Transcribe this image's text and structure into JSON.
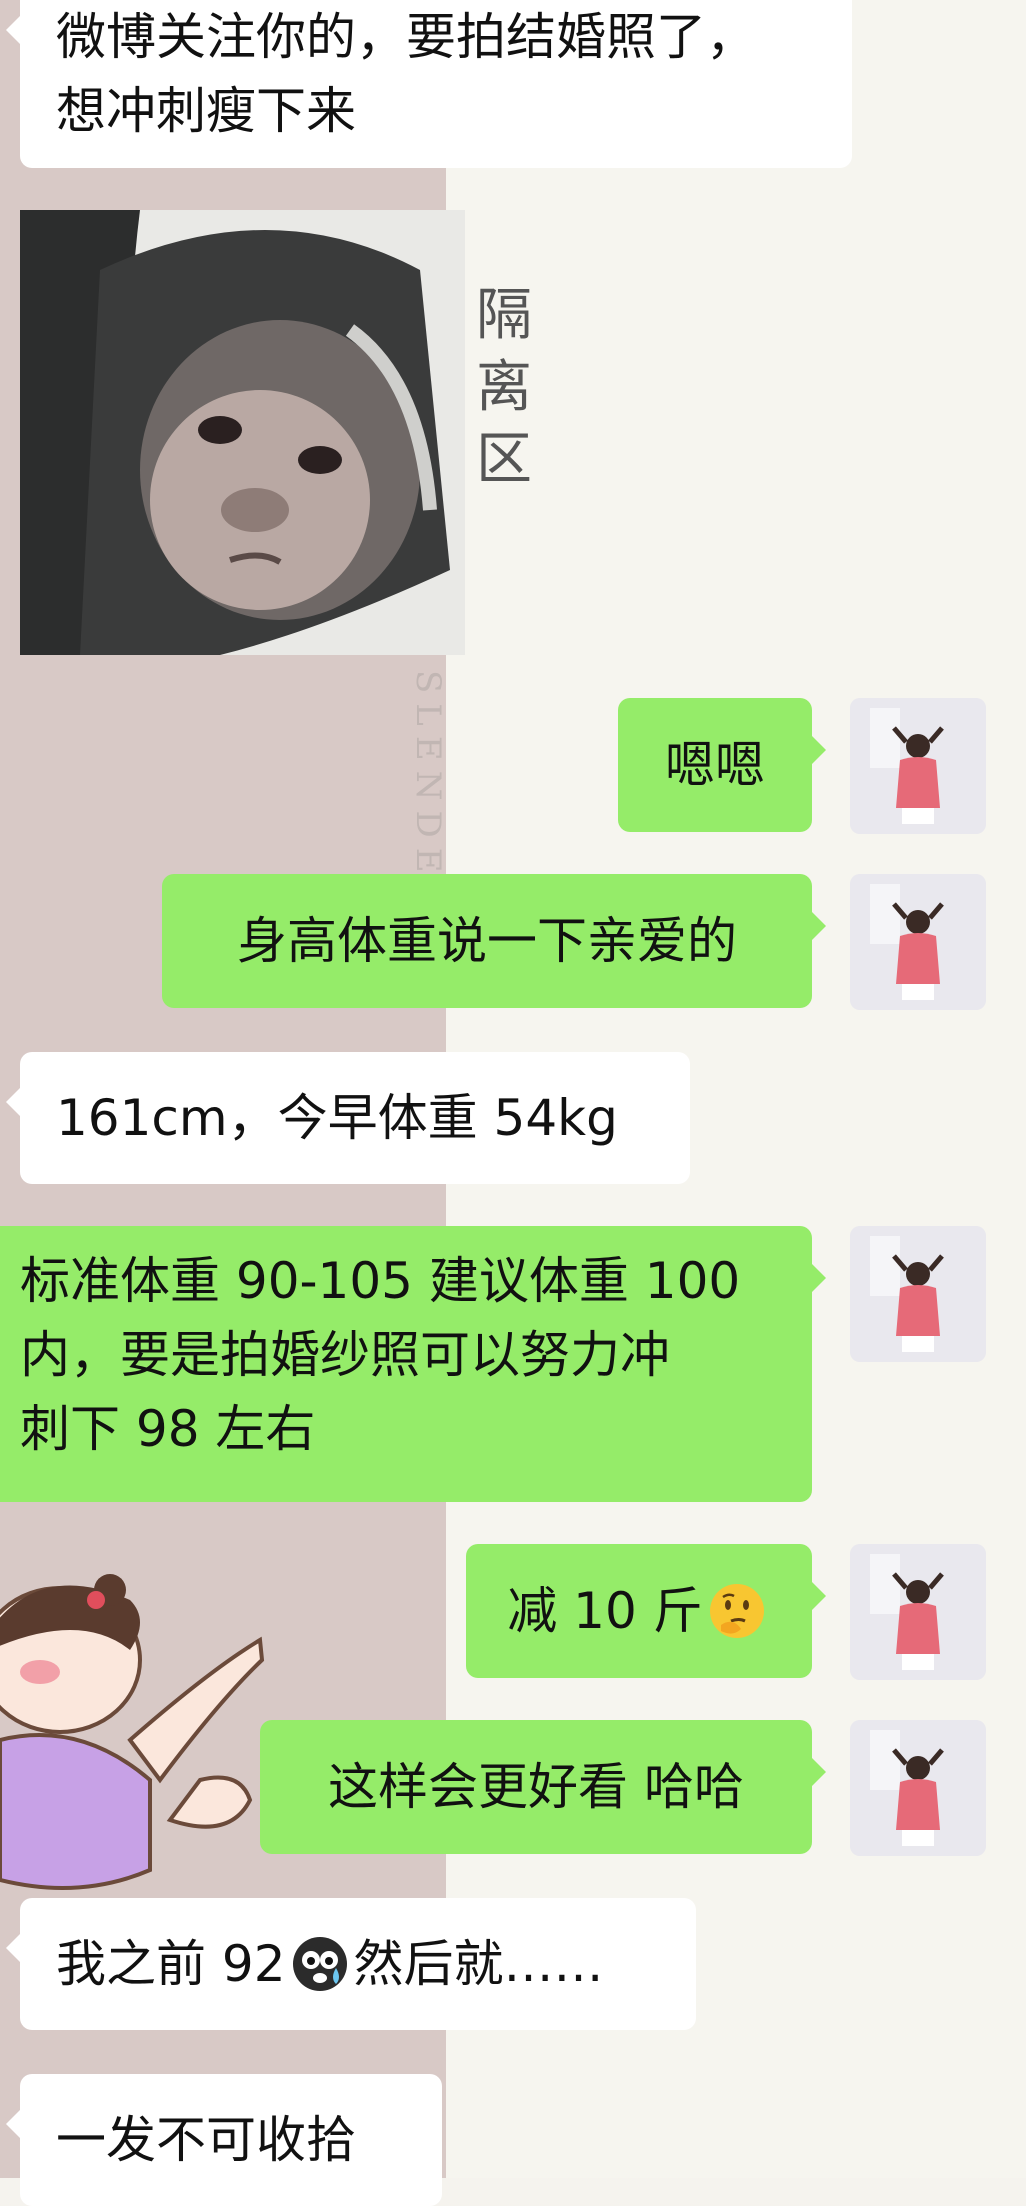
{
  "messages": {
    "m1": {
      "line1": "微博关注你的，要拍结婚照了，",
      "line2": "想冲刺瘦下来"
    },
    "m2": {
      "caption": "隔离区"
    },
    "m3": {
      "text": "嗯嗯"
    },
    "m4": {
      "text": "身高体重说一下亲爱的"
    },
    "m5": {
      "text": "161cm，今早体重 54kg"
    },
    "m6": {
      "line1": "标准体重 90-105 建议体重 100",
      "line2": "内，要是拍婚纱照可以努力冲",
      "line3": "刺下 98 左右"
    },
    "m7": {
      "text": "减 10 斤",
      "emoji": "thinking-face-icon"
    },
    "m8": {
      "text": "这样会更好看 哈哈"
    },
    "m9": {
      "before": "我之前 92",
      "emoji": "crying-face-icon",
      "after": "然后就……"
    },
    "m10": {
      "text": "一发不可收拾"
    }
  },
  "wallpaper": {
    "text": "SLENDER"
  },
  "colors": {
    "outgoing_bubble": "#95ec69",
    "incoming_bubble": "#ffffff",
    "wallpaper_left": "#d8c9c6",
    "wallpaper_right": "#f6f5ef"
  }
}
